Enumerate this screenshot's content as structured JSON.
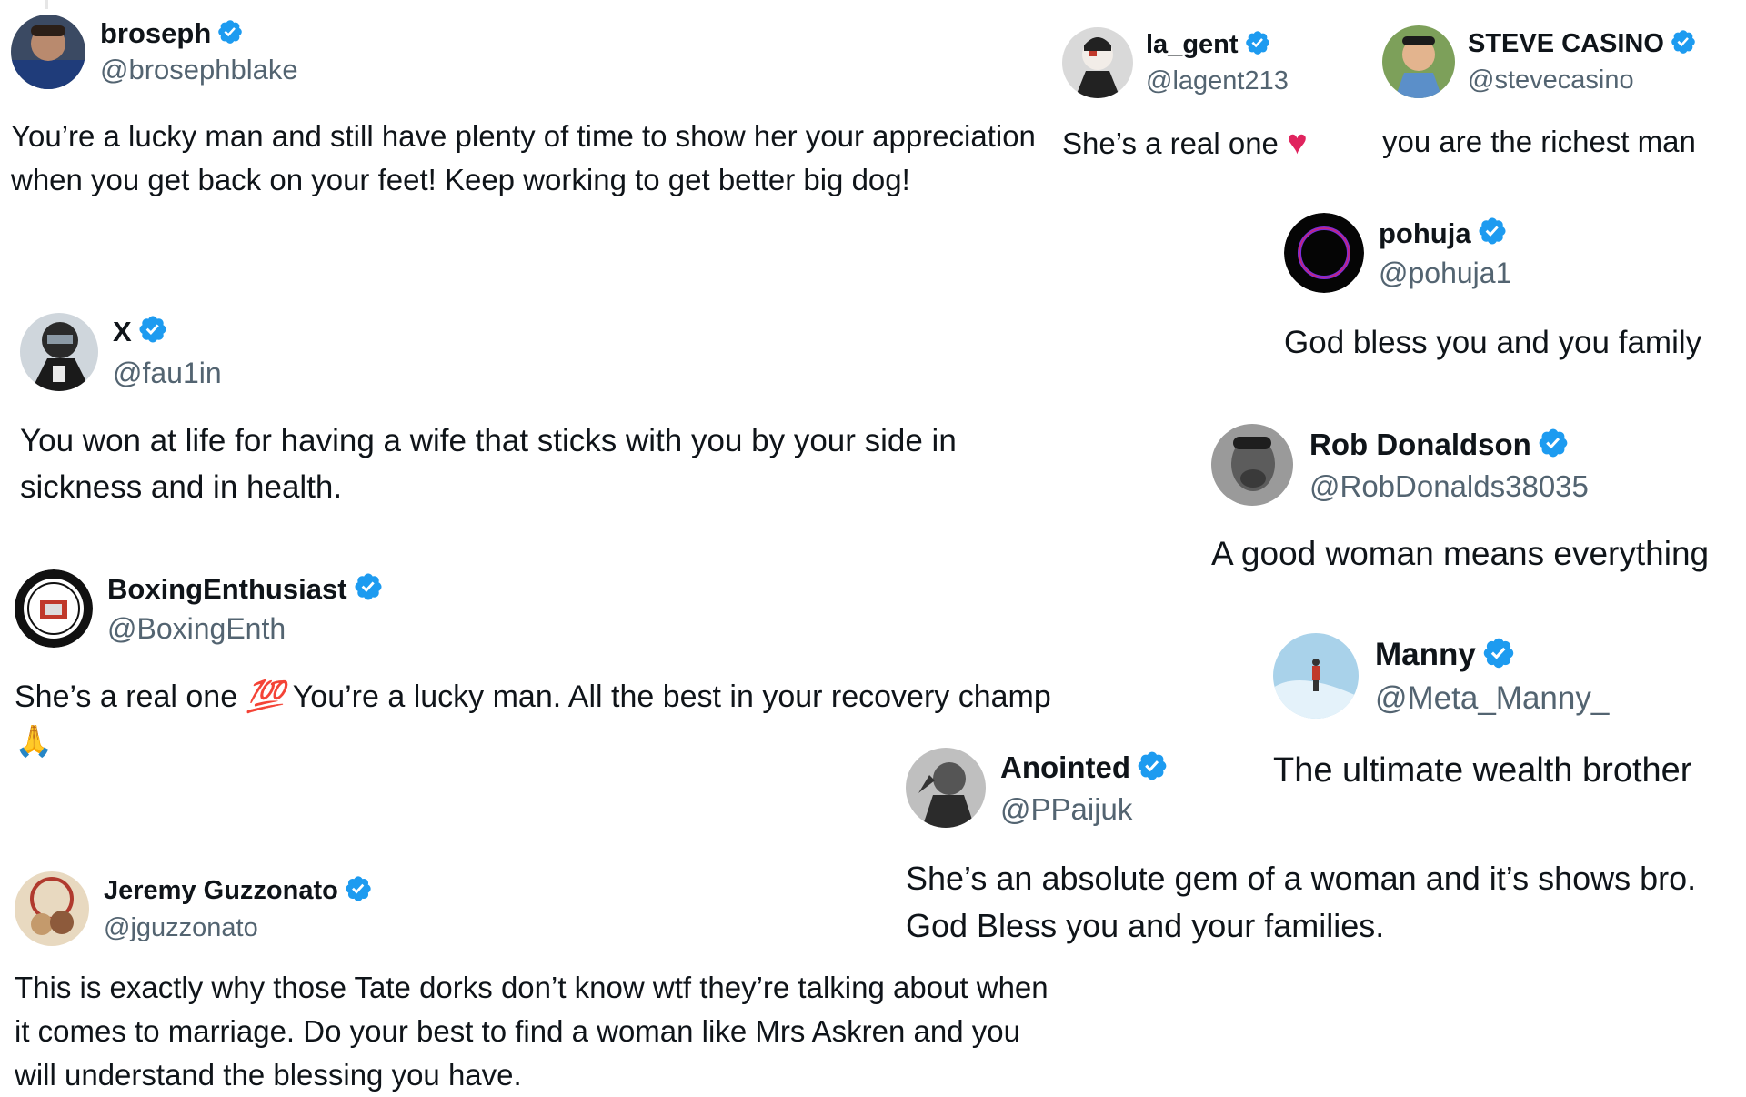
{
  "posts": [
    {
      "name": "broseph",
      "handle": "@brosephblake",
      "text": "You’re a lucky man and still have plenty of time to show her your appreciation when you get back on your feet! Keep working to get better big dog!"
    },
    {
      "name": "X",
      "handle": "@fau1in",
      "text": "You won at life for having a wife that sticks with you by your side in sickness and in health."
    },
    {
      "name": "BoxingEnthusiast",
      "handle": "@BoxingEnth",
      "text_before": "She’s a real one ",
      "emoji_1": "💯",
      "text_middle": " You’re a lucky man. All the best in your recovery champ ",
      "emoji_2": "🙏"
    },
    {
      "name": "Jeremy Guzzonato",
      "handle": "@jguzzonato",
      "text": "This is exactly why those Tate dorks don’t know wtf they’re talking about when it comes to marriage. Do your best to find a woman like Mrs Askren and you will understand the blessing you have."
    },
    {
      "name": "la_gent",
      "handle": "@lagent213",
      "text": "She’s a real one ",
      "emoji": "♥"
    },
    {
      "name": "STEVE CASINO",
      "handle": "@stevecasino",
      "text": "you are the richest man"
    },
    {
      "name": "pohuja",
      "handle": "@pohuja1",
      "text": "God bless you and you family"
    },
    {
      "name": "Rob Donaldson",
      "handle": "@RobDonalds38035",
      "text": "A good woman means everything"
    },
    {
      "name": "Manny",
      "handle": "@Meta_Manny_",
      "text": "The ultimate wealth brother"
    },
    {
      "name": "Anointed",
      "handle": "@PPaijuk",
      "text": "She’s an absolute gem of a woman and it’s shows bro. God Bless you and your families."
    }
  ],
  "colors": {
    "verified": "#1d9bf0",
    "handle": "#536471",
    "text": "#0f1419",
    "heart": "#e0245e"
  },
  "icons": {
    "verified": "verified-badge-icon"
  }
}
